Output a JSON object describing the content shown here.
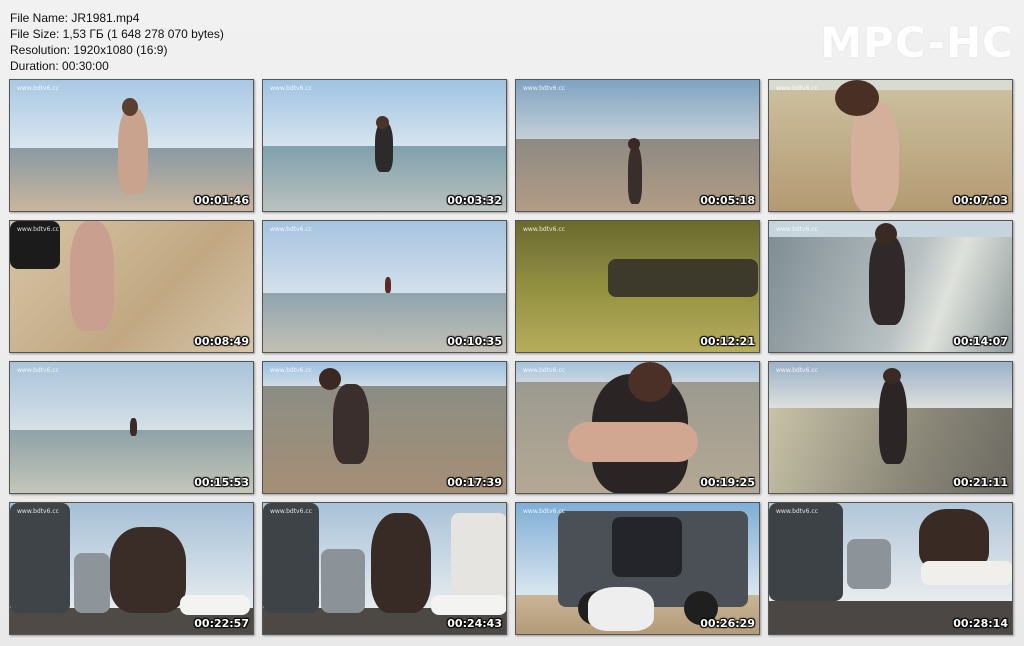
{
  "file_info": {
    "name": "File Name: JR1981.mp4",
    "size": "File Size: 1,53 ГБ (1 648 278 070 bytes)",
    "resolution": "Resolution: 1920x1080 (16:9)",
    "duration": "Duration: 00:30:00"
  },
  "logo": "MPC-HC",
  "watermark": "www.bdtv6.cc",
  "thumbnails": [
    {
      "time": "00:01:46",
      "scene": "beach-standing"
    },
    {
      "time": "00:03:32",
      "scene": "water-standing"
    },
    {
      "time": "00:05:18",
      "scene": "shore-walk"
    },
    {
      "time": "00:07:03",
      "scene": "closeup-back"
    },
    {
      "time": "00:08:49",
      "scene": "sand-closeup"
    },
    {
      "time": "00:10:35",
      "scene": "distant-sea"
    },
    {
      "time": "00:12:21",
      "scene": "underwater"
    },
    {
      "time": "00:14:07",
      "scene": "kneeling-sunset"
    },
    {
      "time": "00:15:53",
      "scene": "distant-sea"
    },
    {
      "time": "00:17:39",
      "scene": "kneeling-shore"
    },
    {
      "time": "00:19:25",
      "scene": "hands-closeup"
    },
    {
      "time": "00:21:11",
      "scene": "walking-sunset"
    },
    {
      "time": "00:22:57",
      "scene": "vehicle-rear"
    },
    {
      "time": "00:24:43",
      "scene": "vehicle-rear"
    },
    {
      "time": "00:26:29",
      "scene": "jeep-beach"
    },
    {
      "time": "00:28:14",
      "scene": "vehicle-rear"
    }
  ]
}
